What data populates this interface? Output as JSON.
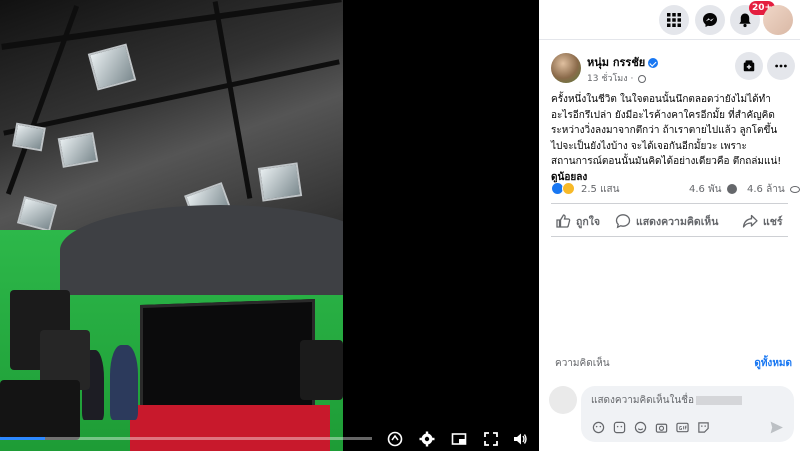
{
  "topbar": {
    "notification_count": "20+"
  },
  "post": {
    "author": "หนุ่ม กรรชัย",
    "time": "13 ชั่วโมง",
    "text_lines": [
      "ครั้งหนึ่งในชีวิต ในใจตอนนั้นนึกตลอดว่ายังไม่ได้ทำ",
      "อะไรอีกรึเปล่า ยังมีอะไรค้างคาใครอีกมั้ย ที่สำคัญคิด",
      "ระหว่างวิ่งลงมาจากตึกว่า ถ้าเราตายไปแล้ว ลูกโตขึ้น",
      "ไปจะเป็นยังไงบ้าง จะได้เจอกันอีกมั้ยวะ เพราะ",
      "สถานการณ์ตอนนั้นมันคิดได้อย่างเดียวคือ ตึกถล่มแน่!"
    ],
    "see_less": "ดูน้อยลง",
    "reactions_count": "2.5 แสน",
    "comments_count": "4.6 พัน",
    "views_count": "4.6 ล้าน"
  },
  "actions": {
    "like": "ถูกใจ",
    "comment": "แสดงความคิดเห็น",
    "share": "แชร์"
  },
  "comments": {
    "label": "ความคิดเห็น",
    "see_all": "ดูทั้งหมด",
    "placeholder": "แสดงความคิดเห็นในชื่อ"
  },
  "video": {
    "progress": 0.12
  },
  "colors": {
    "accent": "#1877f2",
    "notification": "#e41e3f",
    "green_screen": "#2db84a"
  },
  "icons": [
    "grid-menu-icon",
    "messenger-icon",
    "bell-icon",
    "save-icon",
    "more-icon",
    "like-icon",
    "comment-icon",
    "share-icon",
    "settings-icon",
    "pip-icon",
    "fullscreen-icon",
    "volume-icon",
    "captions-icon",
    "send-icon"
  ]
}
